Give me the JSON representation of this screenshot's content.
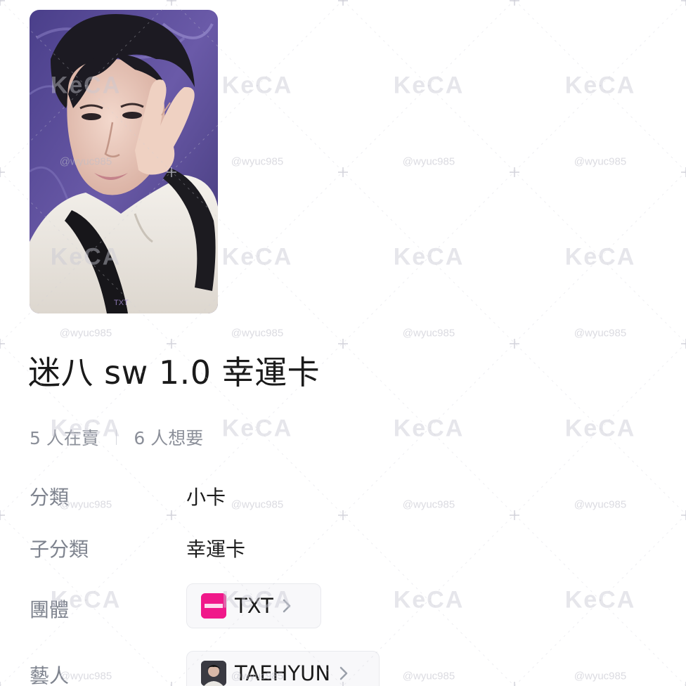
{
  "product": {
    "title": "迷八 sw 1.0 幸運卡",
    "sellers_text": "5 人在賣",
    "wanted_text": "6 人想要"
  },
  "details": {
    "category_label": "分類",
    "category_value": "小卡",
    "subcategory_label": "子分類",
    "subcategory_value": "幸運卡",
    "group_label": "團體",
    "group_value": "TXT",
    "group_icon": "txt-logo-icon",
    "artist_label": "藝人",
    "artist_value": "TAEHYUN",
    "artist_icon": "artist-avatar-icon"
  },
  "watermark": {
    "logo_text": "KeCA",
    "handle_text": "@wyuc985"
  },
  "colors": {
    "group_icon_bg": "#f0188a",
    "label_gray": "#7e838e",
    "stats_gray": "#8b8f99"
  }
}
